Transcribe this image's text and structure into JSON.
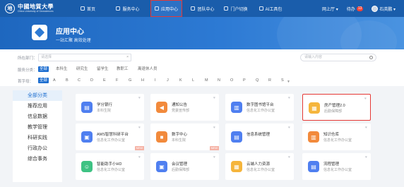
{
  "logo": {
    "cn": "中國地質大學",
    "en": "China University of Geosciences",
    "emblem": "地"
  },
  "nav": {
    "items": [
      {
        "label": "首页",
        "icon": "home-icon"
      },
      {
        "label": "服务中心",
        "icon": "service-icon"
      },
      {
        "label": "应用中心",
        "icon": "apps-icon",
        "active": true
      },
      {
        "label": "团队中心",
        "icon": "team-icon"
      },
      {
        "label": "门户切换",
        "icon": "switch-icon"
      },
      {
        "label": "AI工具包",
        "icon": "ai-icon"
      }
    ],
    "mode_label": "网上厅 ▾",
    "todo_label": "待办",
    "todo_count": "13",
    "user_name": "石英鹏 ▾"
  },
  "banner": {
    "title": "应用中心",
    "subtitle": "一站汇聚  高效处理"
  },
  "filters": {
    "dept_label": "所在部门：",
    "dept_placeholder": "请选择",
    "search_placeholder": "请输入内容",
    "category_label": "服务分类：",
    "categories": [
      "全部",
      "本科生",
      "研究生",
      "留学生",
      "教职工",
      "离退休人员"
    ],
    "initial_label": "首字母：",
    "initials": [
      "全部",
      "A",
      "B",
      "C",
      "D",
      "E",
      "F",
      "G",
      "H",
      "I",
      "J",
      "K",
      "L",
      "M",
      "N",
      "O",
      "P",
      "Q",
      "R",
      "S"
    ]
  },
  "sidebar": {
    "items": [
      "全部分类",
      "推荐应用",
      "信息数据",
      "教学管理",
      "科研实践",
      "行政办公",
      "综合事务"
    ]
  },
  "apps": [
    {
      "name": "学分银行",
      "org": "本科生院",
      "color": "#4f7ff0",
      "icon": "book-icon",
      "glyph": "▤"
    },
    {
      "name": "通知公告",
      "org": "党委宣传部",
      "color": "#f28a3c",
      "icon": "megaphone-icon",
      "glyph": "◀"
    },
    {
      "name": "数字图书馆平台",
      "org": "信息化工作办公室",
      "color": "#4f7ff0",
      "icon": "library-icon",
      "glyph": "▥"
    },
    {
      "name": "房产管理2.0",
      "org": "后勤保障部",
      "color": "#f5b53c",
      "icon": "building-icon",
      "glyph": "▦"
    },
    {
      "name": "AMS智慧科研平台",
      "org": "信息化工作办公室",
      "color": "#4f7ff0",
      "icon": "research-icon",
      "glyph": "▣",
      "tag": "NEW"
    },
    {
      "name": "数字中心",
      "org": "本科生院",
      "color": "#f28a3c",
      "icon": "data-icon",
      "glyph": "■",
      "tag": "NEW"
    },
    {
      "name": "信息系统管理",
      "org": "",
      "color": "#4f7ff0",
      "icon": "system-icon",
      "glyph": "▤"
    },
    {
      "name": "知识仓库",
      "org": "信息化工作办公室",
      "color": "#f28a3c",
      "icon": "warehouse-icon",
      "glyph": "▥"
    },
    {
      "name": "智能助手小HD",
      "org": "信息化工作办公室",
      "color": "#3ec283",
      "icon": "robot-icon",
      "glyph": "☺"
    },
    {
      "name": "会议管理",
      "org": "后勤保障部",
      "color": "#4f7ff0",
      "icon": "meeting-icon",
      "glyph": "▣"
    },
    {
      "name": "云端人力资源",
      "org": "信息化工作办公室",
      "color": "#f5b53c",
      "icon": "hr-icon",
      "glyph": "▦"
    },
    {
      "name": "流程管理",
      "org": "信息化工作办公室",
      "color": "#4f7ff0",
      "icon": "workflow-icon",
      "glyph": "▤"
    }
  ],
  "colors": {
    "primary": "#1a5dab",
    "accent": "#1f6fd0",
    "highlight": "#e53935"
  }
}
